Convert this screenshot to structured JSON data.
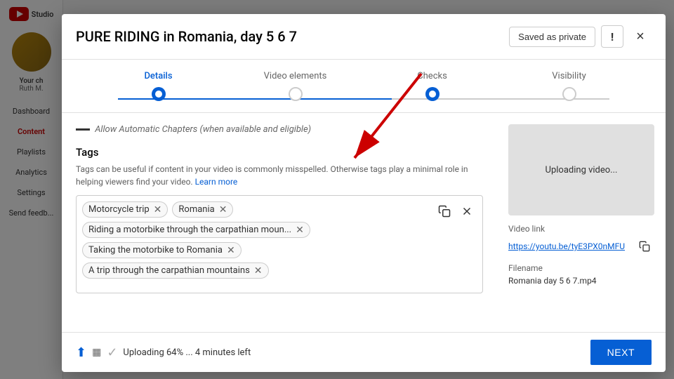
{
  "sidebar": {
    "logo_text": "Studio",
    "channel_label": "Your ch",
    "channel_sublabel": "Ruth M.",
    "items": [
      {
        "label": "Dashboard",
        "active": false
      },
      {
        "label": "Content",
        "active": true
      },
      {
        "label": "Playlists",
        "active": false
      },
      {
        "label": "Analytics",
        "active": false
      },
      {
        "label": "Settings",
        "active": false
      },
      {
        "label": "Send feedb...",
        "active": false
      }
    ]
  },
  "modal": {
    "title": "PURE RIDING in Romania, day 5 6 7",
    "saved_as_private": "Saved as private",
    "close_label": "×",
    "warning_icon": "!",
    "stepper": {
      "steps": [
        {
          "label": "Details",
          "state": "active"
        },
        {
          "label": "Video elements",
          "state": "inactive"
        },
        {
          "label": "Checks",
          "state": "completed"
        },
        {
          "label": "Visibility",
          "state": "inactive"
        }
      ]
    },
    "truncated_hint": "Allow Automatic Chapters (when available and eligible)",
    "tags": {
      "section_title": "Tags",
      "description": "Tags can be useful if content in your video is commonly misspelled. Otherwise tags play a minimal role in helping viewers find your video.",
      "learn_more": "Learn more",
      "tags_list": [
        "Motorcycle trip",
        "Romania",
        "Riding a motorbike through the carpathian moun...",
        "Taking the motorbike to Romania",
        "A trip through the carpathian mountains"
      ]
    },
    "right_panel": {
      "uploading_text": "Uploading video...",
      "video_link_label": "Video link",
      "video_link_url": "https://youtu.be/tyE3PX0nMFU",
      "filename_label": "Filename",
      "filename_value": "Romania day 5 6 7.mp4"
    },
    "footer": {
      "status_text": "Uploading 64% ... 4 minutes left",
      "next_label": "NEXT"
    }
  }
}
